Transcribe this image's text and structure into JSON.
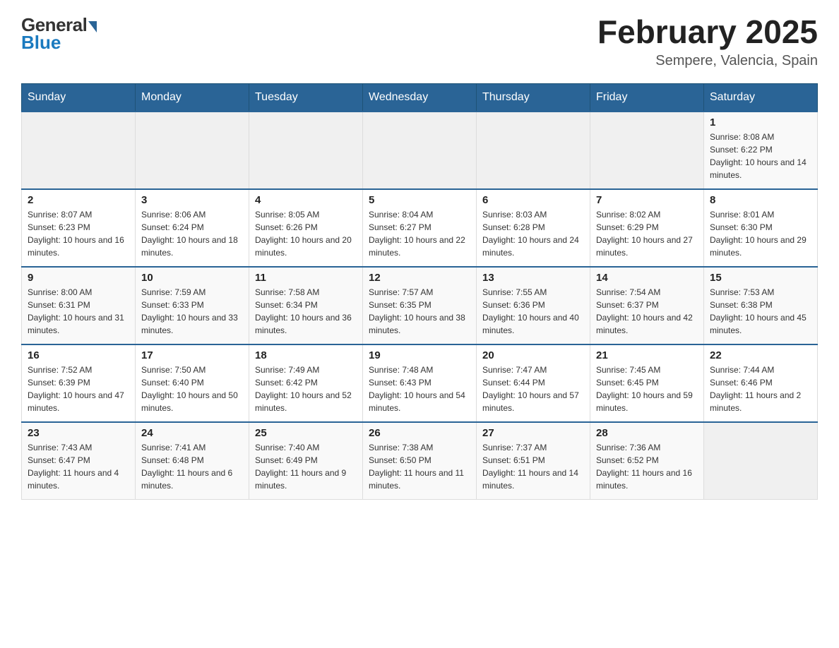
{
  "logo": {
    "general": "General",
    "blue": "Blue",
    "arrow": "▶"
  },
  "title": "February 2025",
  "location": "Sempere, Valencia, Spain",
  "weekdays": [
    "Sunday",
    "Monday",
    "Tuesday",
    "Wednesday",
    "Thursday",
    "Friday",
    "Saturday"
  ],
  "weeks": [
    [
      {
        "day": "",
        "info": ""
      },
      {
        "day": "",
        "info": ""
      },
      {
        "day": "",
        "info": ""
      },
      {
        "day": "",
        "info": ""
      },
      {
        "day": "",
        "info": ""
      },
      {
        "day": "",
        "info": ""
      },
      {
        "day": "1",
        "info": "Sunrise: 8:08 AM\nSunset: 6:22 PM\nDaylight: 10 hours and 14 minutes."
      }
    ],
    [
      {
        "day": "2",
        "info": "Sunrise: 8:07 AM\nSunset: 6:23 PM\nDaylight: 10 hours and 16 minutes."
      },
      {
        "day": "3",
        "info": "Sunrise: 8:06 AM\nSunset: 6:24 PM\nDaylight: 10 hours and 18 minutes."
      },
      {
        "day": "4",
        "info": "Sunrise: 8:05 AM\nSunset: 6:26 PM\nDaylight: 10 hours and 20 minutes."
      },
      {
        "day": "5",
        "info": "Sunrise: 8:04 AM\nSunset: 6:27 PM\nDaylight: 10 hours and 22 minutes."
      },
      {
        "day": "6",
        "info": "Sunrise: 8:03 AM\nSunset: 6:28 PM\nDaylight: 10 hours and 24 minutes."
      },
      {
        "day": "7",
        "info": "Sunrise: 8:02 AM\nSunset: 6:29 PM\nDaylight: 10 hours and 27 minutes."
      },
      {
        "day": "8",
        "info": "Sunrise: 8:01 AM\nSunset: 6:30 PM\nDaylight: 10 hours and 29 minutes."
      }
    ],
    [
      {
        "day": "9",
        "info": "Sunrise: 8:00 AM\nSunset: 6:31 PM\nDaylight: 10 hours and 31 minutes."
      },
      {
        "day": "10",
        "info": "Sunrise: 7:59 AM\nSunset: 6:33 PM\nDaylight: 10 hours and 33 minutes."
      },
      {
        "day": "11",
        "info": "Sunrise: 7:58 AM\nSunset: 6:34 PM\nDaylight: 10 hours and 36 minutes."
      },
      {
        "day": "12",
        "info": "Sunrise: 7:57 AM\nSunset: 6:35 PM\nDaylight: 10 hours and 38 minutes."
      },
      {
        "day": "13",
        "info": "Sunrise: 7:55 AM\nSunset: 6:36 PM\nDaylight: 10 hours and 40 minutes."
      },
      {
        "day": "14",
        "info": "Sunrise: 7:54 AM\nSunset: 6:37 PM\nDaylight: 10 hours and 42 minutes."
      },
      {
        "day": "15",
        "info": "Sunrise: 7:53 AM\nSunset: 6:38 PM\nDaylight: 10 hours and 45 minutes."
      }
    ],
    [
      {
        "day": "16",
        "info": "Sunrise: 7:52 AM\nSunset: 6:39 PM\nDaylight: 10 hours and 47 minutes."
      },
      {
        "day": "17",
        "info": "Sunrise: 7:50 AM\nSunset: 6:40 PM\nDaylight: 10 hours and 50 minutes."
      },
      {
        "day": "18",
        "info": "Sunrise: 7:49 AM\nSunset: 6:42 PM\nDaylight: 10 hours and 52 minutes."
      },
      {
        "day": "19",
        "info": "Sunrise: 7:48 AM\nSunset: 6:43 PM\nDaylight: 10 hours and 54 minutes."
      },
      {
        "day": "20",
        "info": "Sunrise: 7:47 AM\nSunset: 6:44 PM\nDaylight: 10 hours and 57 minutes."
      },
      {
        "day": "21",
        "info": "Sunrise: 7:45 AM\nSunset: 6:45 PM\nDaylight: 10 hours and 59 minutes."
      },
      {
        "day": "22",
        "info": "Sunrise: 7:44 AM\nSunset: 6:46 PM\nDaylight: 11 hours and 2 minutes."
      }
    ],
    [
      {
        "day": "23",
        "info": "Sunrise: 7:43 AM\nSunset: 6:47 PM\nDaylight: 11 hours and 4 minutes."
      },
      {
        "day": "24",
        "info": "Sunrise: 7:41 AM\nSunset: 6:48 PM\nDaylight: 11 hours and 6 minutes."
      },
      {
        "day": "25",
        "info": "Sunrise: 7:40 AM\nSunset: 6:49 PM\nDaylight: 11 hours and 9 minutes."
      },
      {
        "day": "26",
        "info": "Sunrise: 7:38 AM\nSunset: 6:50 PM\nDaylight: 11 hours and 11 minutes."
      },
      {
        "day": "27",
        "info": "Sunrise: 7:37 AM\nSunset: 6:51 PM\nDaylight: 11 hours and 14 minutes."
      },
      {
        "day": "28",
        "info": "Sunrise: 7:36 AM\nSunset: 6:52 PM\nDaylight: 11 hours and 16 minutes."
      },
      {
        "day": "",
        "info": ""
      }
    ]
  ]
}
